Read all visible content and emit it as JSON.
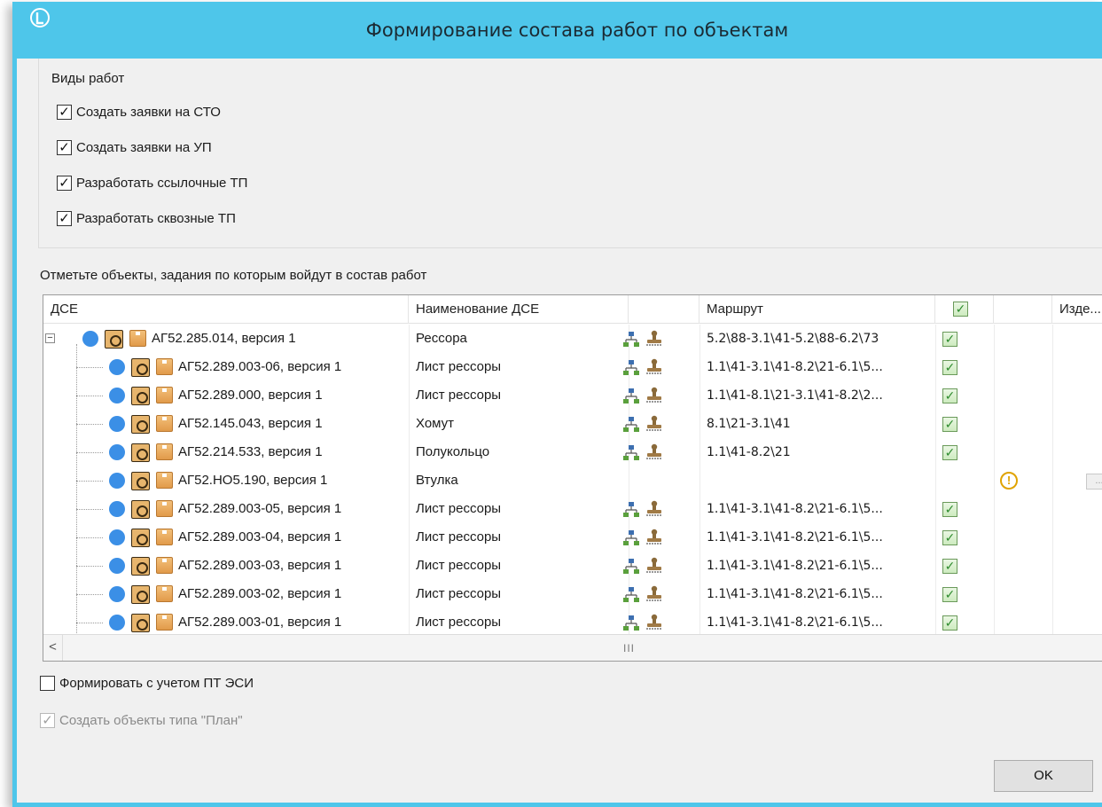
{
  "window": {
    "title": "Формирование состава работ по объектам"
  },
  "work_types": {
    "title": "Виды работ",
    "items": [
      {
        "label": "Создать заявки на СТО",
        "checked": true
      },
      {
        "label": "Создать заявки на УП",
        "checked": true
      },
      {
        "label": "Разработать ссылочные ТП",
        "checked": true
      },
      {
        "label": "Разработать сквозные ТП",
        "checked": true
      }
    ]
  },
  "objects_label": "Отметьте объекты, задания по которым войдут в состав работ",
  "grid": {
    "columns": [
      "ДСЕ",
      "Наименование ДСЕ",
      "",
      "Маршрут",
      "",
      "",
      "Изде..."
    ],
    "check_mark": "✓",
    "warn_mark": "!",
    "expander_mark": "−",
    "mini_button": "...",
    "rows": [
      {
        "dse": "АГ52.285.014, версия 1",
        "name": "Рессора",
        "route": "5.2\\88-3.1\\41-5.2\\88-6.2\\73",
        "icons": true,
        "checked": true,
        "warning": false,
        "root": true
      },
      {
        "dse": "АГ52.289.003-06, версия 1",
        "name": "Лист рессоры",
        "route": "1.1\\41-3.1\\41-8.2\\21-6.1\\5...",
        "icons": true,
        "checked": true,
        "warning": false
      },
      {
        "dse": "АГ52.289.000, версия 1",
        "name": "Лист рессоры",
        "route": "1.1\\41-8.1\\21-3.1\\41-8.2\\2...",
        "icons": true,
        "checked": true,
        "warning": false
      },
      {
        "dse": "АГ52.145.043, версия 1",
        "name": "Хомут",
        "route": "8.1\\21-3.1\\41",
        "icons": true,
        "checked": true,
        "warning": false
      },
      {
        "dse": "АГ52.214.533, версия 1",
        "name": "Полукольцо",
        "route": "1.1\\41-8.2\\21",
        "icons": true,
        "checked": true,
        "warning": false
      },
      {
        "dse": "АГ52.НО5.190, версия 1",
        "name": "Втулка",
        "route": "",
        "icons": false,
        "checked": false,
        "warning": true
      },
      {
        "dse": "АГ52.289.003-05, версия 1",
        "name": "Лист рессоры",
        "route": "1.1\\41-3.1\\41-8.2\\21-6.1\\5...",
        "icons": true,
        "checked": true,
        "warning": false
      },
      {
        "dse": "АГ52.289.003-04, версия 1",
        "name": "Лист рессоры",
        "route": "1.1\\41-3.1\\41-8.2\\21-6.1\\5...",
        "icons": true,
        "checked": true,
        "warning": false
      },
      {
        "dse": "АГ52.289.003-03, версия 1",
        "name": "Лист рессоры",
        "route": "1.1\\41-3.1\\41-8.2\\21-6.1\\5...",
        "icons": true,
        "checked": true,
        "warning": false
      },
      {
        "dse": "АГ52.289.003-02, версия 1",
        "name": "Лист рессоры",
        "route": "1.1\\41-3.1\\41-8.2\\21-6.1\\5...",
        "icons": true,
        "checked": true,
        "warning": false
      },
      {
        "dse": "АГ52.289.003-01, версия 1",
        "name": "Лист рессоры",
        "route": "1.1\\41-3.1\\41-8.2\\21-6.1\\5...",
        "icons": true,
        "checked": true,
        "warning": false
      }
    ],
    "scroll_left": "<",
    "scroll_grip": "III"
  },
  "options": {
    "with_pt_esi": {
      "label": "Формировать с учетом ПТ ЭСИ",
      "checked": false
    },
    "create_plan": {
      "label": "Создать объекты типа \"План\"",
      "checked": true,
      "disabled": true
    }
  },
  "ok_button": "OK",
  "colors": {
    "titlebar": "#4ec6ea",
    "node_dot": "#3b8fe6",
    "check_green": "#2e8b2e",
    "warning": "#e0a300"
  }
}
